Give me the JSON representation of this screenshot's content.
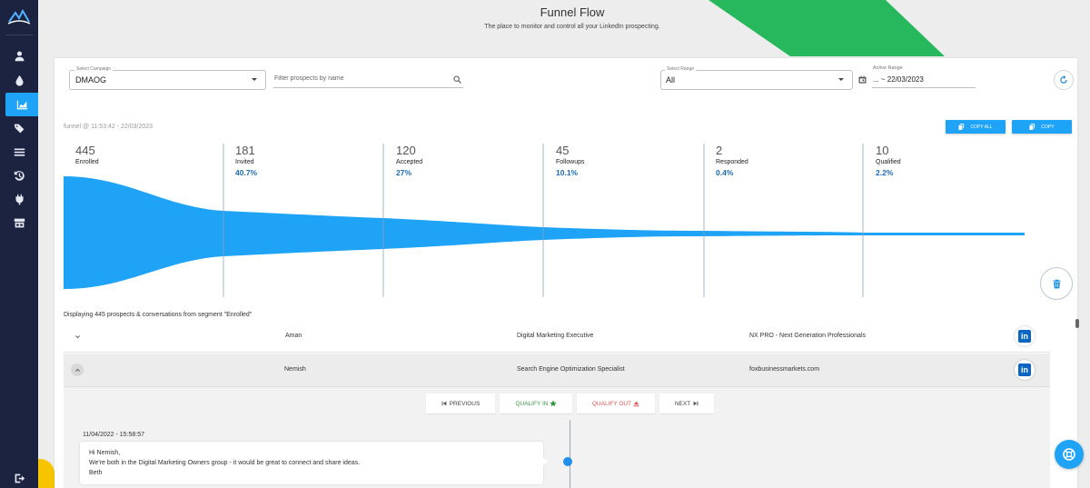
{
  "header": {
    "title": "Funnel Flow",
    "subtitle": "The place to monitor and control all your LinkedIn prospecting."
  },
  "colors": {
    "accent": "#1ea3f7",
    "sidebar": "#1c2340",
    "green_banner": "#27b85e",
    "linkedin": "#0a66c2"
  },
  "sidebar": {
    "items": [
      {
        "icon": "person-icon"
      },
      {
        "icon": "drop-icon"
      },
      {
        "icon": "chart-icon",
        "active": true
      },
      {
        "icon": "tags-icon"
      },
      {
        "icon": "inbox-icon"
      },
      {
        "icon": "history-icon"
      },
      {
        "icon": "plug-icon"
      },
      {
        "icon": "storefront-icon"
      }
    ],
    "logout_icon": "logout-icon"
  },
  "filters": {
    "campaign_label": "Select Campaign",
    "campaign_value": "DMAOG",
    "search_placeholder": "Filter prospects by name",
    "range_label": "Select Range",
    "range_value": "All",
    "active_range_label": "Active Range",
    "active_range_value": "... ~ 22/03/2023"
  },
  "funnel": {
    "caption": "funnel @ 11:53:42 - 22/03/2023",
    "copy_all_label": "COPY ALL",
    "copy_label": "COPY",
    "stages": [
      {
        "count": "445",
        "label": "Enrolled",
        "percent": ""
      },
      {
        "count": "181",
        "label": "Invited",
        "percent": "40.7%"
      },
      {
        "count": "120",
        "label": "Accepted",
        "percent": "27%"
      },
      {
        "count": "45",
        "label": "Followups",
        "percent": "10.1%"
      },
      {
        "count": "2",
        "label": "Responded",
        "percent": "0.4%"
      },
      {
        "count": "10",
        "label": "Qualified",
        "percent": "2.2%"
      }
    ]
  },
  "list": {
    "summary": "Displaying 445 prospects & conversations from segment \"Enrolled\"",
    "rows": [
      {
        "name": "Aman",
        "title": "Digital Marketing Executive",
        "company": "NX PRO - Next Generation Professionals"
      },
      {
        "name": "Nemish",
        "title": "Search Engine Optimization Specialist",
        "company": "foxbusinessmarkets.com"
      }
    ]
  },
  "conversation": {
    "previous_label": "PREVIOUS",
    "qualify_in_label": "QUALIFY IN",
    "qualify_out_label": "QUALIFY OUT",
    "next_label": "NEXT",
    "message_time": "11/04/2022 - 15:58:57",
    "message_lines": [
      "Hi Nemish,",
      "We're both in the Digital Marketing Owners group - it would be great to connect and share ideas.",
      "Beth"
    ]
  }
}
